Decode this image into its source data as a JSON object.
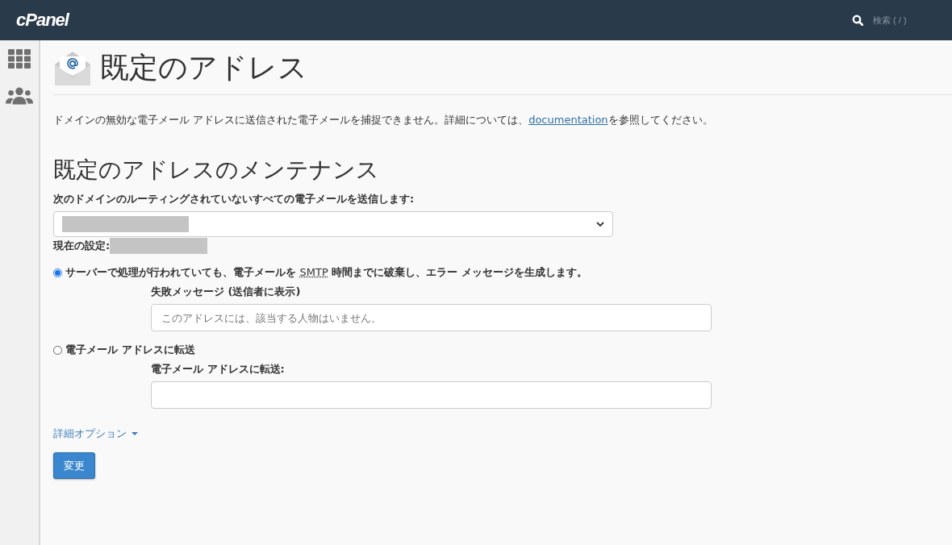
{
  "header": {
    "logo": "cPanel",
    "search_placeholder": "検索 ( / )"
  },
  "sidebar": {
    "items": [
      {
        "kind": "grid",
        "selected": false
      },
      {
        "kind": "users",
        "selected": false
      }
    ]
  },
  "page": {
    "title": "既定のアドレス",
    "description": {
      "before": "ドメインの無効な電子メール アドレスに送信された電子メールを捕捉できません。詳細については、",
      "link": "documentation",
      "after": "を参照してください。"
    },
    "section_title": "既定のアドレスのメンテナンス",
    "domain_label": "次のドメインのルーティングされていないすべての電子メールを送信します:",
    "current_label": "現在の設定:",
    "options": [
      {
        "selected": true,
        "label_before": "サーバーで処理が行われていても、電子メールを ",
        "label_abbr": "SMTP",
        "label_after": " 時間までに破棄し、エラー メッセージを生成します。",
        "field_label": "失敗メッセージ (送信者に表示)",
        "placeholder": "このアドレスには、該当する人物はいません。"
      },
      {
        "selected": false,
        "label_before": "電子メール アドレスに転送",
        "field_label": "電子メール アドレスに転送:"
      }
    ],
    "advanced": "詳細オプション",
    "submit": "変更"
  }
}
